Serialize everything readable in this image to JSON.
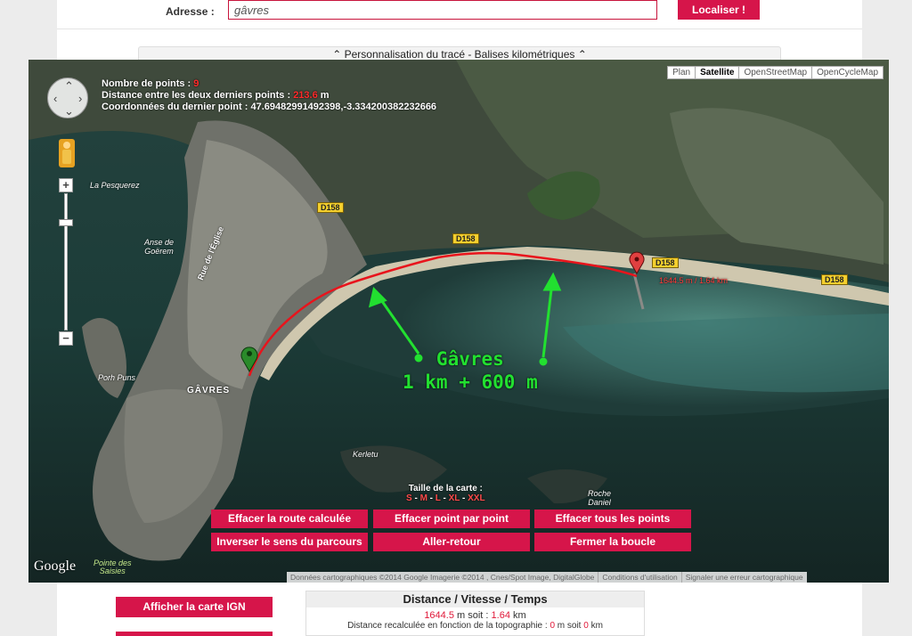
{
  "address": {
    "label": "Adresse :",
    "value": "gâvres",
    "locate_button": "Localiser !"
  },
  "personalisation_bar": "⌃ Personnalisation du tracé - Balises kilométriques ⌃",
  "map": {
    "info": {
      "points_label": "Nombre de points : ",
      "points_value": "9",
      "distance_label": "Distance entre les deux derniers points : ",
      "distance_value": "213.6",
      "distance_unit": " m",
      "coords_label": "Coordonnées du dernier point : ",
      "coords_value": "47.69482991492398,-3.334200382232666"
    },
    "map_types": [
      "Plan",
      "Satellite",
      "OpenStreetMap",
      "OpenCycleMap"
    ],
    "active_map_type": "Satellite",
    "places": {
      "pesquerez": "La Pesquerez",
      "anse": "Anse de",
      "goerem": "Goërem",
      "rue_eglise": "Rue de l'Église",
      "porh_puns": "Porh Puns",
      "gavres": "GÂVRES",
      "kerletu": "Kerletu",
      "roche": "Roche",
      "daniel": "Daniel",
      "pointe1": "Pointe des",
      "pointe2": "Saisies"
    },
    "roads": [
      "D158",
      "D158",
      "D158",
      "D158"
    ],
    "distance_marker_label": "1644.5 m / 1.64 km",
    "annotation": {
      "line1": "Gâvres",
      "line2": "1 km + 600 m"
    },
    "size": {
      "label": "Taille de la carte :",
      "options": [
        "S",
        "M",
        "L",
        "XL",
        "XXL"
      ],
      "separator": " - "
    },
    "buttons": {
      "clear_route": "Effacer la route calculée",
      "clear_point": "Effacer point par point",
      "clear_all": "Effacer tous les points",
      "reverse": "Inverser le sens du parcours",
      "round_trip": "Aller-retour",
      "close_loop": "Fermer la boucle"
    },
    "google": "Google",
    "attribution": [
      "Données cartographiques ©2014 Google Imagerie ©2014 , Cnes/Spot Image, DigitalGlobe",
      "Conditions d'utilisation",
      "Signaler une erreur cartographique"
    ],
    "colors": {
      "route": "#e8141c",
      "annotation": "#22e030"
    }
  },
  "bottom": {
    "ign_button": "Afficher la carte IGN",
    "dvt": {
      "title": "Distance / Vitesse / Temps",
      "distance_m": "1644.5",
      "m_unit": " m soit : ",
      "distance_km": "1.64",
      "km_unit": " km",
      "recalc_label": "Distance recalculée en fonction de la topographie : ",
      "recalc_m": "0",
      "recalc_mid": " m soit ",
      "recalc_km": "0",
      "recalc_km_unit": " km"
    }
  },
  "colors": {
    "brand_red": "#d6154a",
    "page_bg": "#ececec"
  }
}
